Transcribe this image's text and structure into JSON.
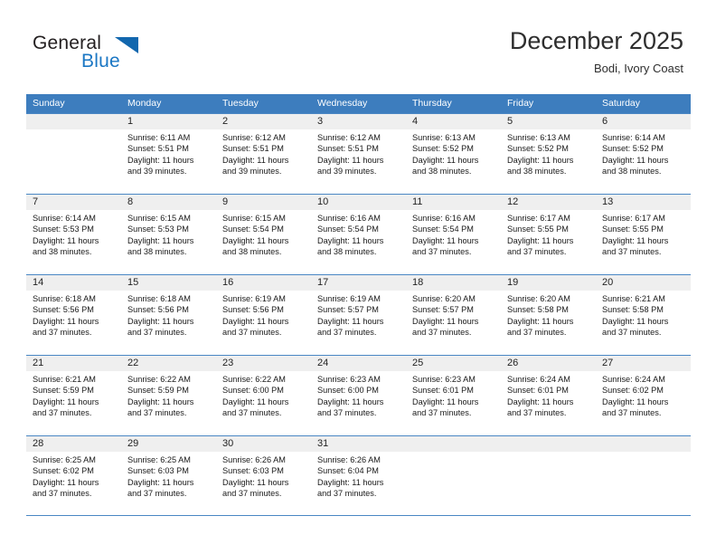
{
  "brand": {
    "name_part1": "General",
    "name_part2": "Blue",
    "accent_color": "#1b77c4",
    "triangle_color": "#1267ae"
  },
  "header": {
    "month_title": "December 2025",
    "location": "Bodi, Ivory Coast"
  },
  "calendar": {
    "header_bg": "#3d7dbe",
    "daynum_bg": "#efefef",
    "weekdays": [
      "Sunday",
      "Monday",
      "Tuesday",
      "Wednesday",
      "Thursday",
      "Friday",
      "Saturday"
    ],
    "weeks": [
      [
        {
          "day": "",
          "sunrise": "",
          "sunset": "",
          "daylight": "",
          "daylight2": ""
        },
        {
          "day": "1",
          "sunrise": "Sunrise: 6:11 AM",
          "sunset": "Sunset: 5:51 PM",
          "daylight": "Daylight: 11 hours",
          "daylight2": "and 39 minutes."
        },
        {
          "day": "2",
          "sunrise": "Sunrise: 6:12 AM",
          "sunset": "Sunset: 5:51 PM",
          "daylight": "Daylight: 11 hours",
          "daylight2": "and 39 minutes."
        },
        {
          "day": "3",
          "sunrise": "Sunrise: 6:12 AM",
          "sunset": "Sunset: 5:51 PM",
          "daylight": "Daylight: 11 hours",
          "daylight2": "and 39 minutes."
        },
        {
          "day": "4",
          "sunrise": "Sunrise: 6:13 AM",
          "sunset": "Sunset: 5:52 PM",
          "daylight": "Daylight: 11 hours",
          "daylight2": "and 38 minutes."
        },
        {
          "day": "5",
          "sunrise": "Sunrise: 6:13 AM",
          "sunset": "Sunset: 5:52 PM",
          "daylight": "Daylight: 11 hours",
          "daylight2": "and 38 minutes."
        },
        {
          "day": "6",
          "sunrise": "Sunrise: 6:14 AM",
          "sunset": "Sunset: 5:52 PM",
          "daylight": "Daylight: 11 hours",
          "daylight2": "and 38 minutes."
        }
      ],
      [
        {
          "day": "7",
          "sunrise": "Sunrise: 6:14 AM",
          "sunset": "Sunset: 5:53 PM",
          "daylight": "Daylight: 11 hours",
          "daylight2": "and 38 minutes."
        },
        {
          "day": "8",
          "sunrise": "Sunrise: 6:15 AM",
          "sunset": "Sunset: 5:53 PM",
          "daylight": "Daylight: 11 hours",
          "daylight2": "and 38 minutes."
        },
        {
          "day": "9",
          "sunrise": "Sunrise: 6:15 AM",
          "sunset": "Sunset: 5:54 PM",
          "daylight": "Daylight: 11 hours",
          "daylight2": "and 38 minutes."
        },
        {
          "day": "10",
          "sunrise": "Sunrise: 6:16 AM",
          "sunset": "Sunset: 5:54 PM",
          "daylight": "Daylight: 11 hours",
          "daylight2": "and 38 minutes."
        },
        {
          "day": "11",
          "sunrise": "Sunrise: 6:16 AM",
          "sunset": "Sunset: 5:54 PM",
          "daylight": "Daylight: 11 hours",
          "daylight2": "and 37 minutes."
        },
        {
          "day": "12",
          "sunrise": "Sunrise: 6:17 AM",
          "sunset": "Sunset: 5:55 PM",
          "daylight": "Daylight: 11 hours",
          "daylight2": "and 37 minutes."
        },
        {
          "day": "13",
          "sunrise": "Sunrise: 6:17 AM",
          "sunset": "Sunset: 5:55 PM",
          "daylight": "Daylight: 11 hours",
          "daylight2": "and 37 minutes."
        }
      ],
      [
        {
          "day": "14",
          "sunrise": "Sunrise: 6:18 AM",
          "sunset": "Sunset: 5:56 PM",
          "daylight": "Daylight: 11 hours",
          "daylight2": "and 37 minutes."
        },
        {
          "day": "15",
          "sunrise": "Sunrise: 6:18 AM",
          "sunset": "Sunset: 5:56 PM",
          "daylight": "Daylight: 11 hours",
          "daylight2": "and 37 minutes."
        },
        {
          "day": "16",
          "sunrise": "Sunrise: 6:19 AM",
          "sunset": "Sunset: 5:56 PM",
          "daylight": "Daylight: 11 hours",
          "daylight2": "and 37 minutes."
        },
        {
          "day": "17",
          "sunrise": "Sunrise: 6:19 AM",
          "sunset": "Sunset: 5:57 PM",
          "daylight": "Daylight: 11 hours",
          "daylight2": "and 37 minutes."
        },
        {
          "day": "18",
          "sunrise": "Sunrise: 6:20 AM",
          "sunset": "Sunset: 5:57 PM",
          "daylight": "Daylight: 11 hours",
          "daylight2": "and 37 minutes."
        },
        {
          "day": "19",
          "sunrise": "Sunrise: 6:20 AM",
          "sunset": "Sunset: 5:58 PM",
          "daylight": "Daylight: 11 hours",
          "daylight2": "and 37 minutes."
        },
        {
          "day": "20",
          "sunrise": "Sunrise: 6:21 AM",
          "sunset": "Sunset: 5:58 PM",
          "daylight": "Daylight: 11 hours",
          "daylight2": "and 37 minutes."
        }
      ],
      [
        {
          "day": "21",
          "sunrise": "Sunrise: 6:21 AM",
          "sunset": "Sunset: 5:59 PM",
          "daylight": "Daylight: 11 hours",
          "daylight2": "and 37 minutes."
        },
        {
          "day": "22",
          "sunrise": "Sunrise: 6:22 AM",
          "sunset": "Sunset: 5:59 PM",
          "daylight": "Daylight: 11 hours",
          "daylight2": "and 37 minutes."
        },
        {
          "day": "23",
          "sunrise": "Sunrise: 6:22 AM",
          "sunset": "Sunset: 6:00 PM",
          "daylight": "Daylight: 11 hours",
          "daylight2": "and 37 minutes."
        },
        {
          "day": "24",
          "sunrise": "Sunrise: 6:23 AM",
          "sunset": "Sunset: 6:00 PM",
          "daylight": "Daylight: 11 hours",
          "daylight2": "and 37 minutes."
        },
        {
          "day": "25",
          "sunrise": "Sunrise: 6:23 AM",
          "sunset": "Sunset: 6:01 PM",
          "daylight": "Daylight: 11 hours",
          "daylight2": "and 37 minutes."
        },
        {
          "day": "26",
          "sunrise": "Sunrise: 6:24 AM",
          "sunset": "Sunset: 6:01 PM",
          "daylight": "Daylight: 11 hours",
          "daylight2": "and 37 minutes."
        },
        {
          "day": "27",
          "sunrise": "Sunrise: 6:24 AM",
          "sunset": "Sunset: 6:02 PM",
          "daylight": "Daylight: 11 hours",
          "daylight2": "and 37 minutes."
        }
      ],
      [
        {
          "day": "28",
          "sunrise": "Sunrise: 6:25 AM",
          "sunset": "Sunset: 6:02 PM",
          "daylight": "Daylight: 11 hours",
          "daylight2": "and 37 minutes."
        },
        {
          "day": "29",
          "sunrise": "Sunrise: 6:25 AM",
          "sunset": "Sunset: 6:03 PM",
          "daylight": "Daylight: 11 hours",
          "daylight2": "and 37 minutes."
        },
        {
          "day": "30",
          "sunrise": "Sunrise: 6:26 AM",
          "sunset": "Sunset: 6:03 PM",
          "daylight": "Daylight: 11 hours",
          "daylight2": "and 37 minutes."
        },
        {
          "day": "31",
          "sunrise": "Sunrise: 6:26 AM",
          "sunset": "Sunset: 6:04 PM",
          "daylight": "Daylight: 11 hours",
          "daylight2": "and 37 minutes."
        },
        {
          "day": "",
          "sunrise": "",
          "sunset": "",
          "daylight": "",
          "daylight2": ""
        },
        {
          "day": "",
          "sunrise": "",
          "sunset": "",
          "daylight": "",
          "daylight2": ""
        },
        {
          "day": "",
          "sunrise": "",
          "sunset": "",
          "daylight": "",
          "daylight2": ""
        }
      ]
    ]
  }
}
